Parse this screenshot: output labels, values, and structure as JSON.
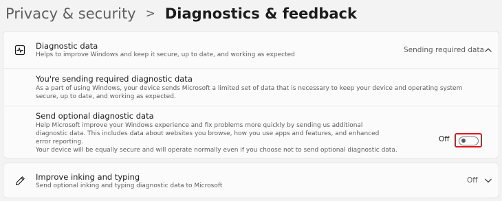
{
  "breadcrumb": {
    "parent": "Privacy & security",
    "separator": ">",
    "current": "Diagnostics & feedback"
  },
  "diagnostic_data": {
    "icon": "diagnostic-pulse-icon",
    "title": "Diagnostic data",
    "subtitle": "Helps to improve Windows and keep it secure, up to date, and working as expected",
    "status": "Sending required data",
    "expanded": true,
    "required_section": {
      "title": "You're sending required diagnostic data",
      "description": "As a part of using Windows, your device sends Microsoft a limited set of data that is necessary to keep your device and operating system secure, up to date, and working as expected."
    },
    "optional_section": {
      "title": "Send optional diagnostic data",
      "description": "Help Microsoft improve your Windows experience and fix problems more quickly by sending us additional diagnostic data. This includes data about websites you browse, how you use apps and features, and enhanced error reporting.",
      "note": "Your device will be equally secure and will operate normally even if you choose not to send optional diagnostic data.",
      "toggle_label": "Off",
      "toggle_on": false,
      "highlight_color": "#e0141b"
    }
  },
  "inking": {
    "icon": "pen-icon",
    "title": "Improve inking and typing",
    "subtitle": "Send optional inking and typing diagnostic data to Microsoft",
    "status": "Off",
    "expanded": false
  }
}
